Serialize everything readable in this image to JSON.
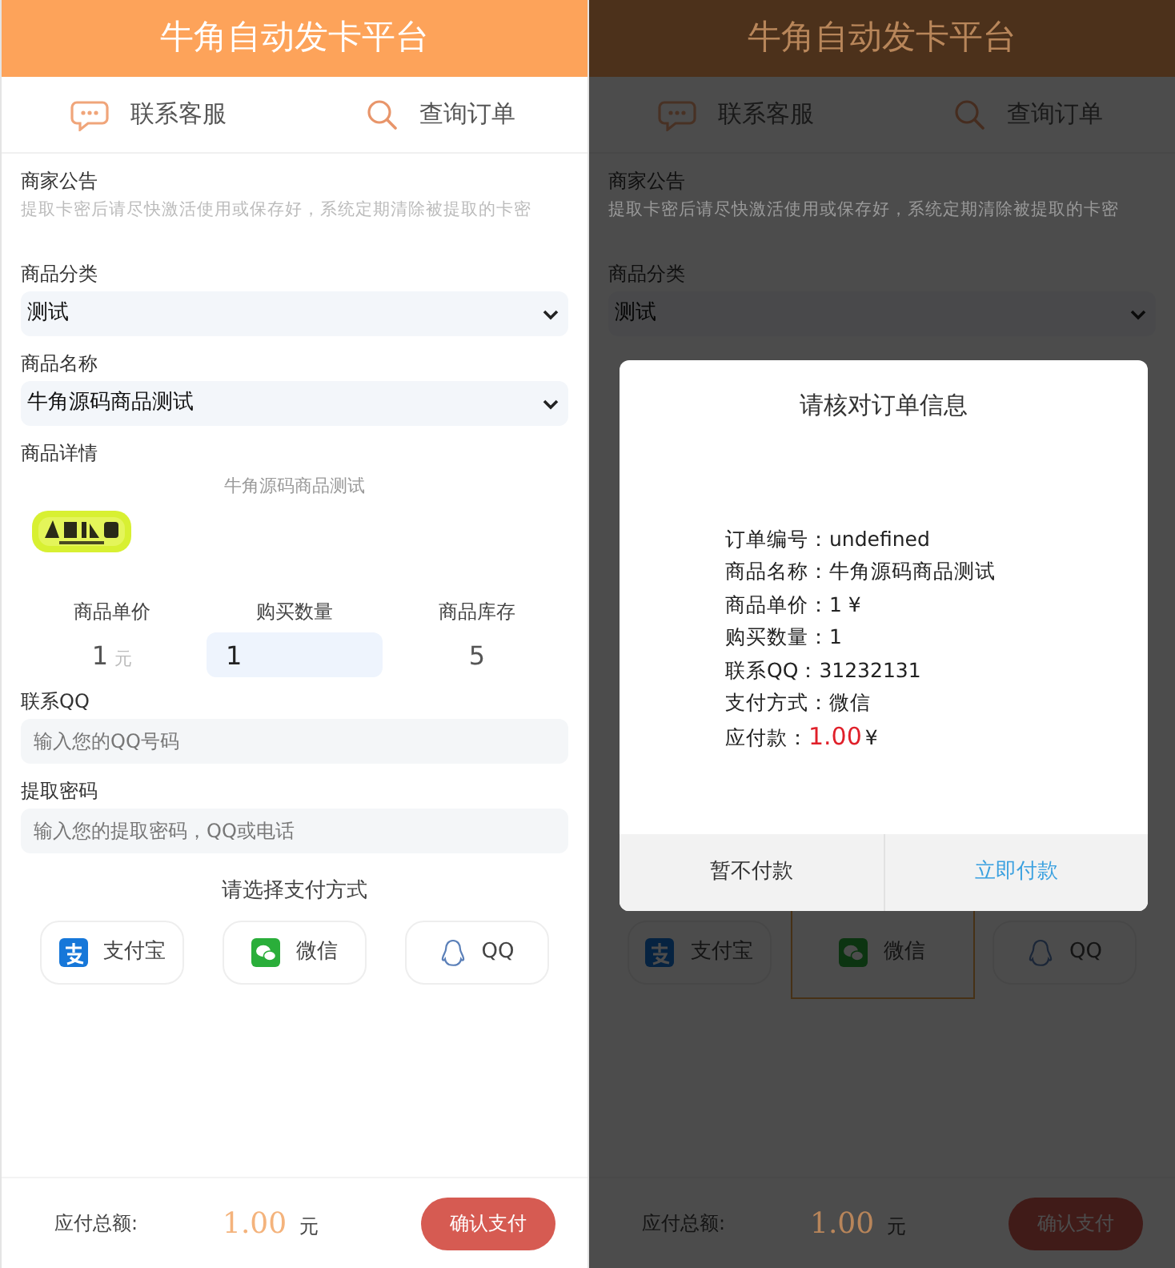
{
  "screens": [
    {
      "header": {
        "title": "牛角自动发卡平台"
      },
      "nav": [
        {
          "label": "联系客服",
          "kind": "chat"
        },
        {
          "label": "查询订单",
          "kind": "search"
        }
      ],
      "notice": {
        "title": "商家公告",
        "text": "提取卡密后请尽快激活使用或保存好，系统定期清除被提取的卡密"
      },
      "fields": [
        {
          "kind": "select",
          "label": "商品分类",
          "value": "测试"
        },
        {
          "kind": "select",
          "label": "商品名称",
          "value": "牛角源码商品测试"
        },
        {
          "kind": "details",
          "label": "商品详情",
          "text": "牛角源码商品测试"
        },
        {
          "kind": "price_row",
          "columns": [
            {
              "kind": "text",
              "label": "商品单价",
              "value": "1",
              "unit": "元"
            },
            {
              "kind": "input",
              "label": "购买数量",
              "value": "1"
            },
            {
              "kind": "text",
              "label": "商品库存",
              "value": "5"
            }
          ]
        },
        {
          "kind": "input",
          "label": "联系QQ",
          "placeholder": "输入您的QQ号码"
        },
        {
          "kind": "input",
          "label": "提取密码",
          "placeholder": "输入您的提取密码，QQ或电话"
        }
      ],
      "payment_prompt": "请选择支付方式",
      "payments": [
        {
          "kind": "alipay",
          "label": "支付宝",
          "selected": false
        },
        {
          "kind": "wechat",
          "label": "微信",
          "selected": false
        },
        {
          "kind": "qq",
          "label": "QQ",
          "selected": false
        }
      ],
      "footer": {
        "label": "应付总额:",
        "amount": "1.00",
        "unit": "元",
        "button": "确认支付"
      }
    },
    {
      "header": {
        "title": "牛角自动发卡平台"
      },
      "nav": [
        {
          "label": "联系客服",
          "kind": "chat"
        },
        {
          "label": "查询订单",
          "kind": "search"
        }
      ],
      "notice": {
        "title": "商家公告",
        "text": "提取卡密后请尽快激活使用或保存好，系统定期清除被提取的卡密"
      },
      "fields": [
        {
          "kind": "select",
          "label": "商品分类",
          "value": "测试"
        }
      ],
      "payments": [
        {
          "kind": "alipay",
          "label": "支付宝",
          "selected": false
        },
        {
          "kind": "wechat",
          "label": "微信",
          "selected": true
        },
        {
          "kind": "qq",
          "label": "QQ",
          "selected": false
        }
      ],
      "footer": {
        "label": "应付总额:",
        "amount": "1.00",
        "unit": "元",
        "button": "确认支付"
      },
      "modal": {
        "title": "请核对订单信息",
        "lines": [
          {
            "kind": "plain",
            "label": "订单编号：",
            "value": "undefined"
          },
          {
            "kind": "plain",
            "label": "商品名称：",
            "value": "牛角源码商品测试"
          },
          {
            "kind": "plain",
            "label": "商品单价：",
            "value": "1 ¥"
          },
          {
            "kind": "plain",
            "label": "购买数量：",
            "value": "1"
          },
          {
            "kind": "plain",
            "label": "联系QQ：",
            "value": "31232131"
          },
          {
            "kind": "plain",
            "label": "支付方式：",
            "value": "微信"
          },
          {
            "kind": "amount",
            "label": "应付款：",
            "value": "1.00",
            "unit": "¥"
          }
        ],
        "buttons": [
          {
            "kind": "cancel",
            "label": "暂不付款"
          },
          {
            "kind": "confirm",
            "label": "立即付款"
          }
        ]
      }
    }
  ]
}
